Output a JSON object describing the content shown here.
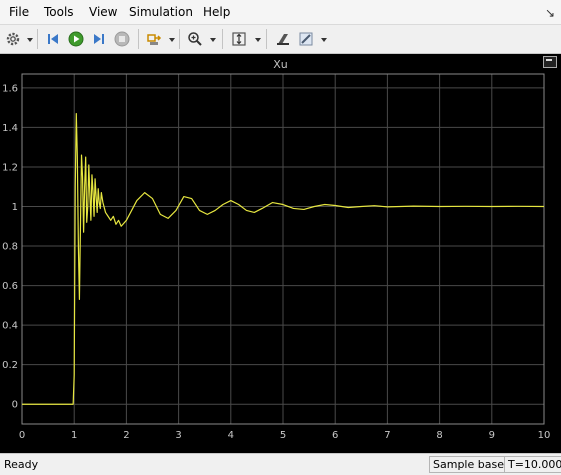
{
  "menu": [
    "File",
    "Tools",
    "View",
    "Simulation",
    "Help"
  ],
  "toolbar": {
    "icons": [
      "settings-icon",
      "step-back-icon",
      "run-icon",
      "step-forward-icon",
      "stop-icon",
      "highlight-icon",
      "zoom-icon",
      "scale-axes-icon",
      "cursor-measure-icon",
      "triggers-icon"
    ]
  },
  "scope": {
    "title": "Xu",
    "background": "#000000",
    "trace_color": "#e6e640"
  },
  "chart_data": {
    "type": "line",
    "title": "Xu",
    "xlabel": "",
    "ylabel": "",
    "xlim": [
      0,
      10
    ],
    "ylim": [
      -0.1,
      1.67
    ],
    "grid": true,
    "xticks": [
      "0",
      "1",
      "2",
      "3",
      "4",
      "5",
      "6",
      "7",
      "8",
      "9",
      "10"
    ],
    "yticks": [
      "0",
      "0.2",
      "0.4",
      "0.6",
      "0.8",
      "1",
      "1.2",
      "1.4",
      "1.6"
    ],
    "series": [
      {
        "color": "#e6e640",
        "x": [
          0,
          0.98,
          1.0,
          1.02,
          1.04,
          1.06,
          1.08,
          1.1,
          1.12,
          1.14,
          1.16,
          1.18,
          1.2,
          1.22,
          1.24,
          1.26,
          1.28,
          1.3,
          1.32,
          1.34,
          1.36,
          1.38,
          1.4,
          1.42,
          1.44,
          1.46,
          1.48,
          1.5,
          1.52,
          1.55,
          1.6,
          1.65,
          1.7,
          1.75,
          1.8,
          1.85,
          1.9,
          2.0,
          2.1,
          2.2,
          2.35,
          2.5,
          2.65,
          2.8,
          2.95,
          3.1,
          3.25,
          3.4,
          3.55,
          3.7,
          3.85,
          4.0,
          4.15,
          4.3,
          4.45,
          4.6,
          4.8,
          5.0,
          5.2,
          5.4,
          5.6,
          5.8,
          6.0,
          6.25,
          6.5,
          6.75,
          7.0,
          7.5,
          8.0,
          8.5,
          9.0,
          9.5,
          10.0
        ],
        "y": [
          0,
          0,
          0.15,
          1.1,
          1.47,
          1.25,
          0.8,
          0.53,
          0.9,
          1.26,
          1.15,
          0.87,
          1.1,
          1.25,
          0.92,
          1.0,
          1.21,
          1.06,
          0.93,
          1.16,
          1.08,
          0.95,
          1.14,
          1.05,
          0.97,
          1.09,
          1.02,
          0.99,
          1.07,
          1.02,
          0.97,
          0.95,
          0.93,
          0.95,
          0.91,
          0.93,
          0.9,
          0.93,
          0.98,
          1.03,
          1.07,
          1.04,
          0.96,
          0.94,
          0.98,
          1.05,
          1.04,
          0.98,
          0.96,
          0.98,
          1.01,
          1.03,
          1.01,
          0.98,
          0.97,
          0.99,
          1.02,
          1.01,
          0.99,
          0.985,
          1.0,
          1.01,
          1.005,
          0.995,
          1.0,
          1.004,
          0.998,
          1.002,
          1.0,
          1.001,
          1.0,
          1.001,
          1.0
        ]
      }
    ]
  },
  "status": {
    "ready": "Ready",
    "mode": "Sample based",
    "time": "T=10.000"
  }
}
